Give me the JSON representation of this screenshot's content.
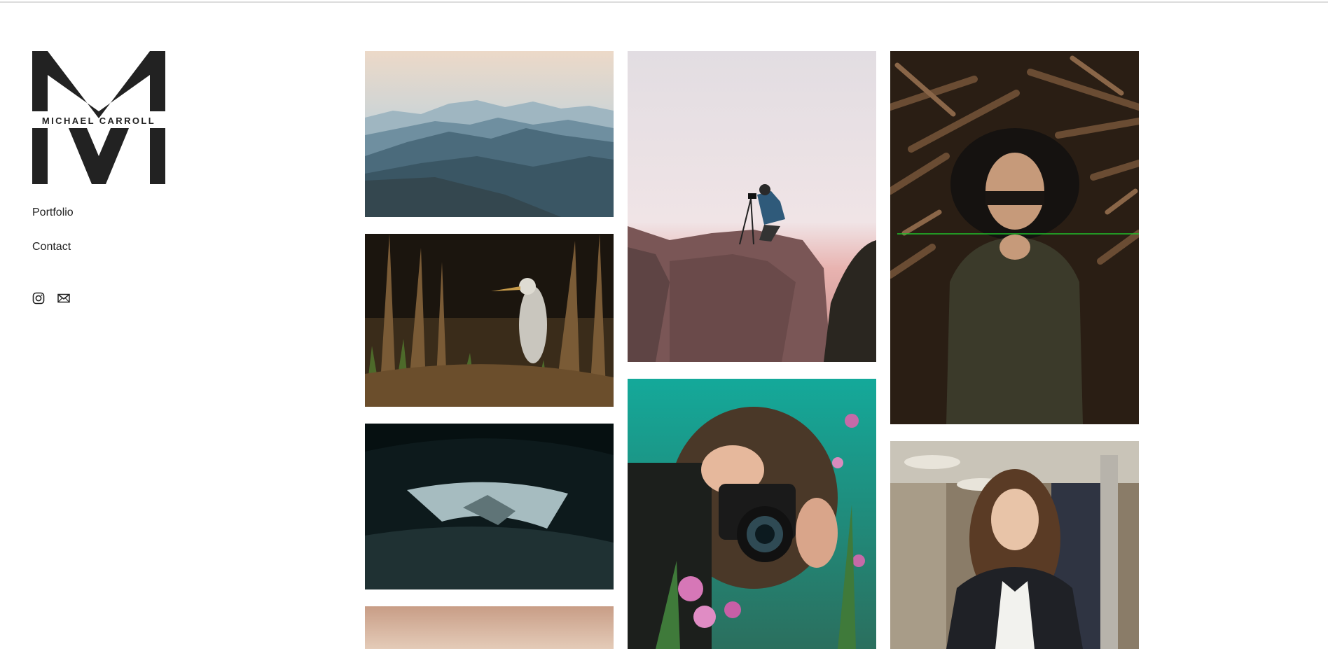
{
  "brand": {
    "monogram": "M",
    "name": "MICHAEL CARROLL"
  },
  "nav": {
    "items": [
      "Portfolio",
      "Contact"
    ]
  },
  "social": {
    "icons": [
      "instagram-icon",
      "mail-icon"
    ]
  },
  "gallery": {
    "photos": [
      "mountain-range",
      "photographer-on-rock",
      "woman-in-hat",
      "heron-in-reeds",
      "ice-cave",
      "woman-with-camera",
      "sunset-horizon",
      "businesswoman-portrait"
    ]
  }
}
